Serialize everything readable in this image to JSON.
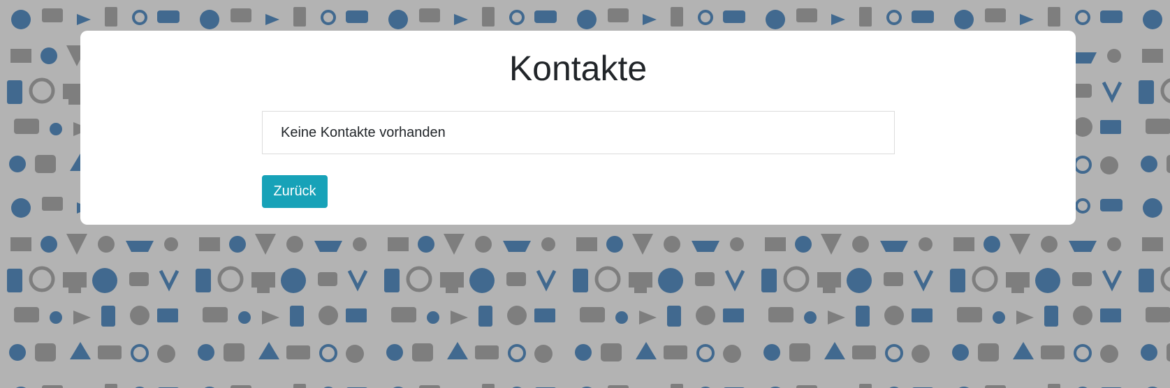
{
  "page": {
    "title": "Kontakte"
  },
  "contacts": {
    "empty_message": "Keine Kontakte vorhanden"
  },
  "actions": {
    "back_label": "Zurück"
  },
  "colors": {
    "background": "#b3b3b3",
    "pattern_blue": "#41698f",
    "pattern_gray": "#7e7e7e",
    "card": "#ffffff",
    "button": "#17a2b8",
    "text": "#212529"
  }
}
